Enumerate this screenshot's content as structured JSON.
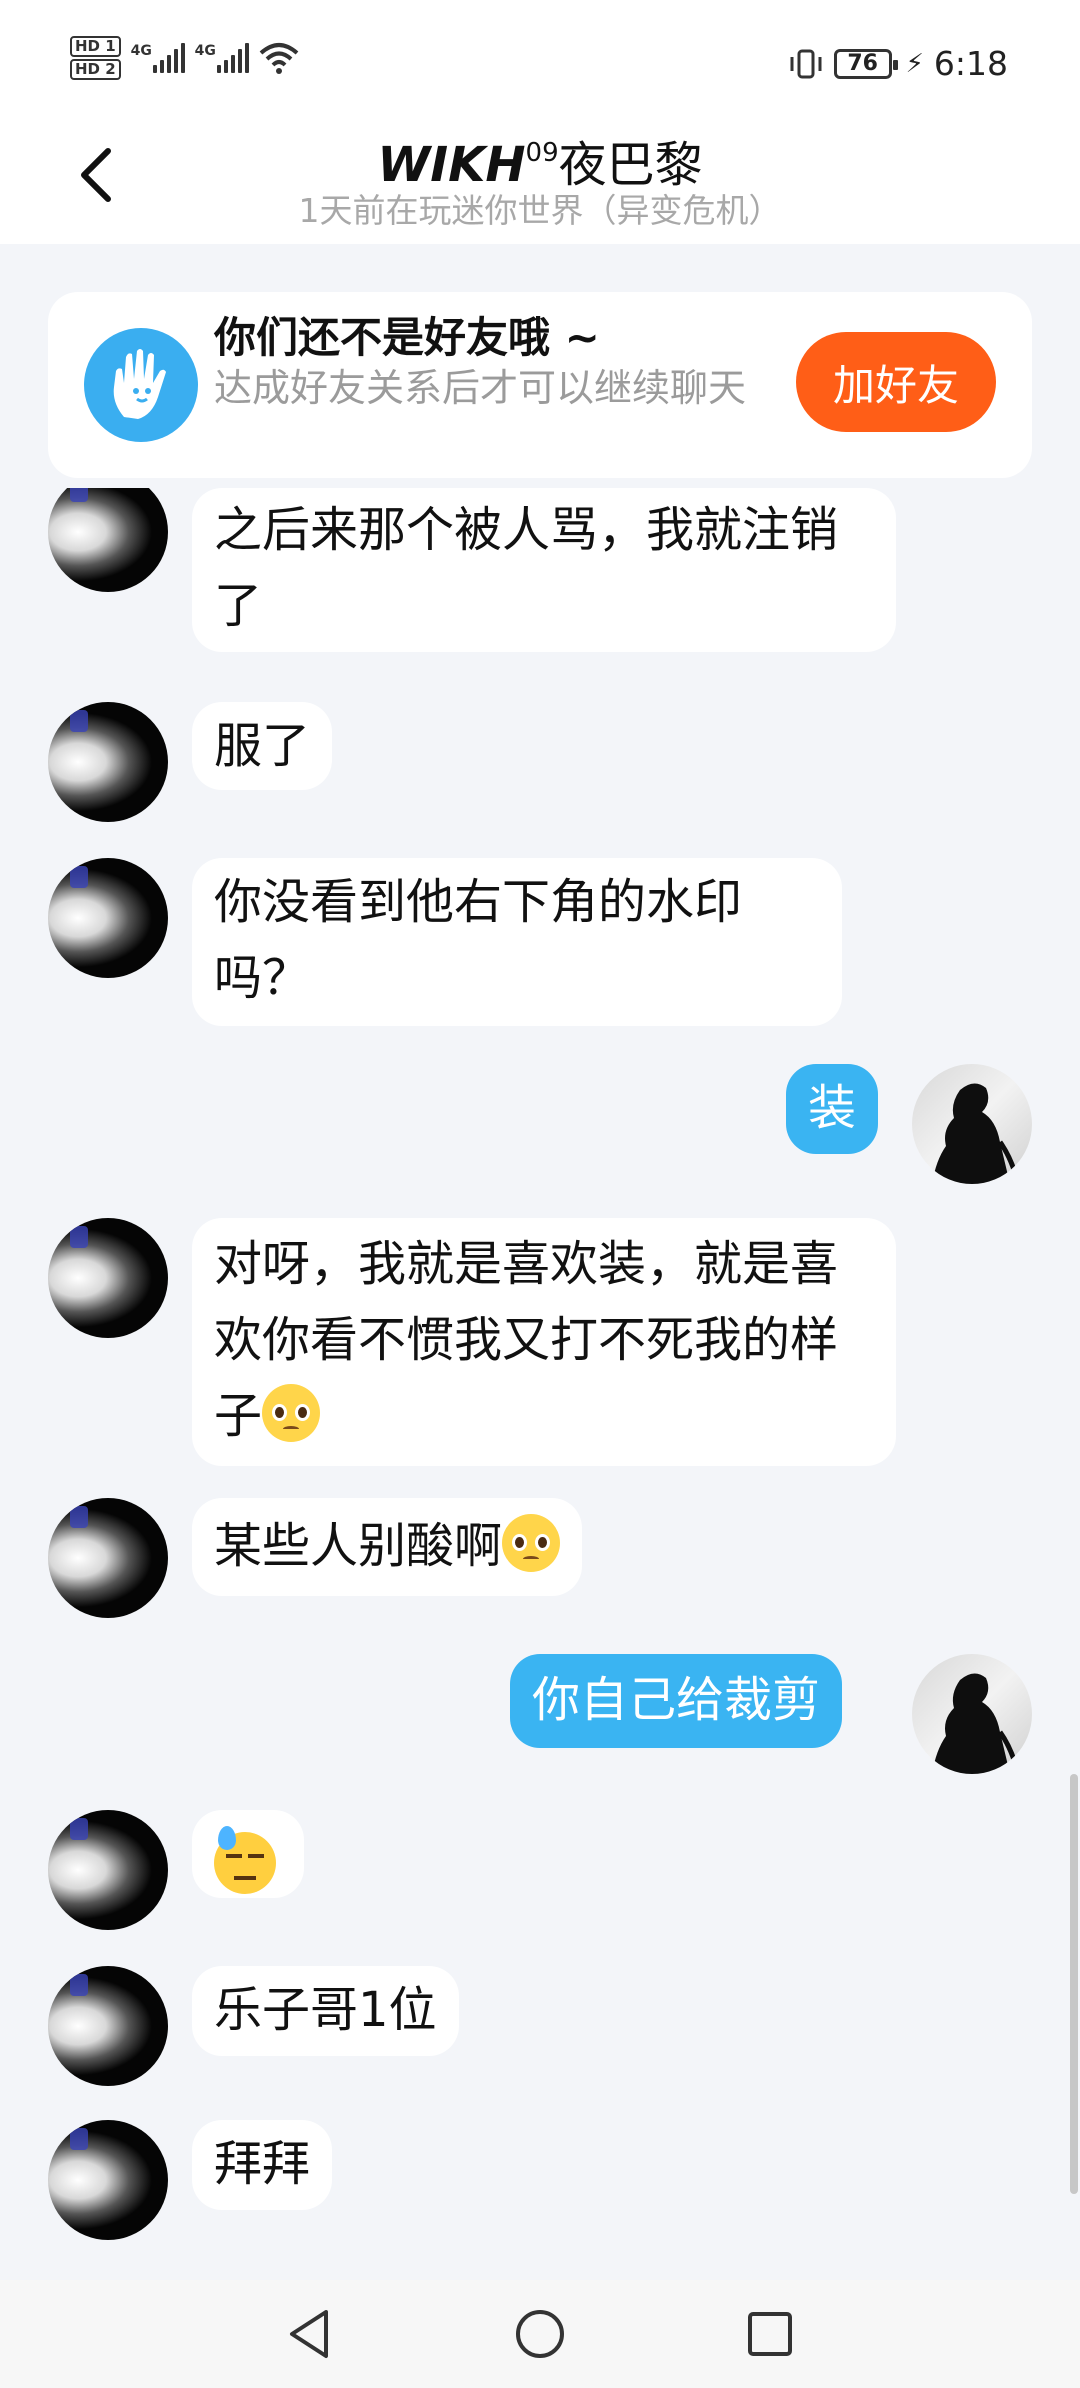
{
  "status_bar": {
    "hd1": "HD 1",
    "hd2": "HD 2",
    "network1": "4G",
    "network2": "4G",
    "battery": "76",
    "time": "6:18",
    "icons": [
      "hd-icon",
      "signal-icon",
      "wifi-icon",
      "vibrate-icon",
      "battery-icon",
      "charging-icon"
    ]
  },
  "header": {
    "title_latin": "WIKH",
    "title_sup": "09",
    "title_cn": "夜巴黎",
    "subtitle": "1天前在玩迷你世界（异变危机）"
  },
  "friend_banner": {
    "title": "你们还不是好友哦 ~",
    "description": "达成好友关系后才可以继续聊天",
    "button": "加好友",
    "button_color": "#ff5e17"
  },
  "messages": [
    {
      "side": "in",
      "text": "之后来那个被人骂，我就注销了"
    },
    {
      "side": "in",
      "text": "服了"
    },
    {
      "side": "in",
      "text": "你没看到他右下角的水印吗？"
    },
    {
      "side": "out",
      "text": "装"
    },
    {
      "side": "in",
      "text": "对呀，我就是喜欢装，就是喜欢你看不惯我又打不死我的样子",
      "emoji": "pleading-face"
    },
    {
      "side": "in",
      "text": "某些人别酸啊",
      "emoji": "pleading-face"
    },
    {
      "side": "out",
      "text": "你自己给裁剪"
    },
    {
      "side": "in",
      "text": "",
      "emoji": "downcast-sweat-face"
    },
    {
      "side": "in",
      "text": "乐子哥1位"
    },
    {
      "side": "in",
      "text": "拜拜"
    }
  ],
  "colors": {
    "out_bubble": "#3ab4f2",
    "in_bubble": "#ffffff",
    "background": "#f3f5f9"
  },
  "nav": {
    "icons": [
      "back-triangle-icon",
      "home-circle-icon",
      "recents-square-icon"
    ]
  }
}
